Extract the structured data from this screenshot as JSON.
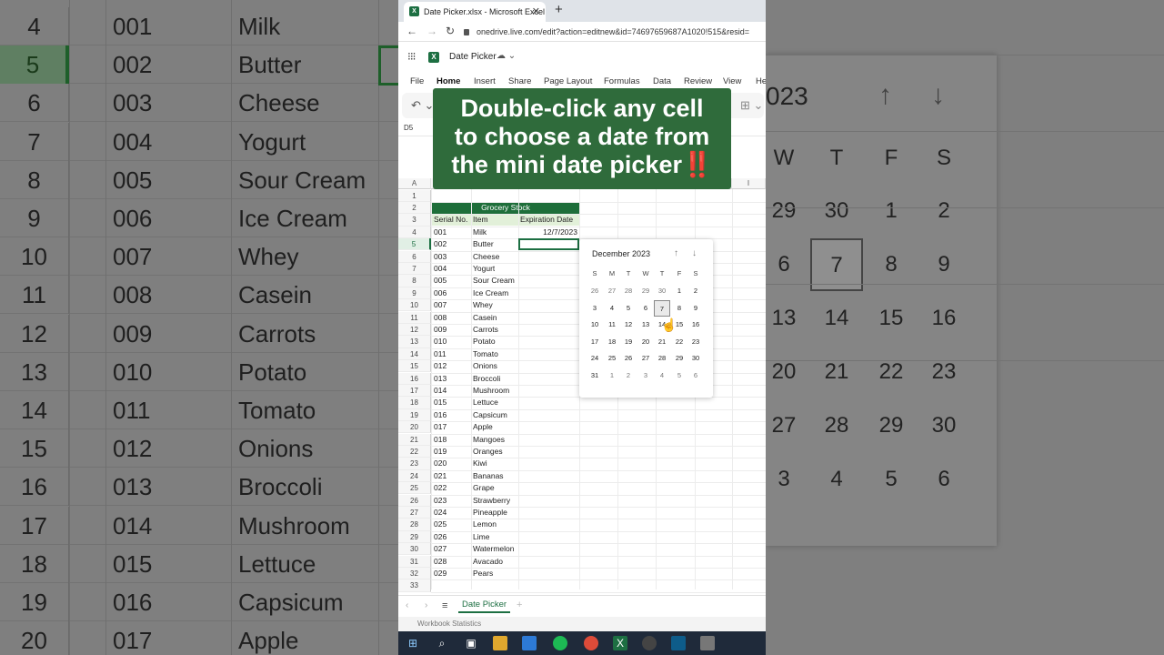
{
  "browser": {
    "tab_title": "Date Picker.xlsx - Microsoft Excel",
    "tab_close": "✕",
    "new_tab": "+",
    "url": "onedrive.live.com/edit?action=editnew&id=74697659687A1020!515&resid="
  },
  "app": {
    "doc_title": "Date Picker",
    "ribbon_tabs": [
      "File",
      "Home",
      "Insert",
      "Share",
      "Page Layout",
      "Formulas",
      "Data",
      "Review",
      "View",
      "He"
    ],
    "name_box": "D5"
  },
  "caption": {
    "line1": "Double-click any cell",
    "line2": "to choose a date from",
    "line3": "the mini date picker",
    "emoji": "‼️"
  },
  "sheet": {
    "col_headers": [
      "A",
      "",
      "",
      "",
      "",
      "",
      "",
      "",
      "I"
    ],
    "table_title": "Grocery Stock",
    "headers": [
      "Serial No.",
      "Item",
      "Expiration Date"
    ],
    "rows": [
      [
        "001",
        "Milk",
        "12/7/2023"
      ],
      [
        "002",
        "Butter",
        ""
      ],
      [
        "003",
        "Cheese",
        ""
      ],
      [
        "004",
        "Yogurt",
        ""
      ],
      [
        "005",
        "Sour Cream",
        ""
      ],
      [
        "006",
        "Ice Cream",
        ""
      ],
      [
        "007",
        "Whey",
        ""
      ],
      [
        "008",
        "Casein",
        ""
      ],
      [
        "009",
        "Carrots",
        ""
      ],
      [
        "010",
        "Potato",
        ""
      ],
      [
        "011",
        "Tomato",
        ""
      ],
      [
        "012",
        "Onions",
        ""
      ],
      [
        "013",
        "Broccoli",
        ""
      ],
      [
        "014",
        "Mushroom",
        ""
      ],
      [
        "015",
        "Lettuce",
        ""
      ],
      [
        "016",
        "Capsicum",
        ""
      ],
      [
        "017",
        "Apple",
        ""
      ],
      [
        "018",
        "Mangoes",
        ""
      ],
      [
        "019",
        "Oranges",
        ""
      ],
      [
        "020",
        "Kiwi",
        ""
      ],
      [
        "021",
        "Bananas",
        ""
      ],
      [
        "022",
        "Grape",
        ""
      ],
      [
        "023",
        "Strawberry",
        ""
      ],
      [
        "024",
        "Pineapple",
        ""
      ],
      [
        "025",
        "Lemon",
        ""
      ],
      [
        "026",
        "Lime",
        ""
      ],
      [
        "027",
        "Watermelon",
        ""
      ],
      [
        "028",
        "Avacado",
        ""
      ],
      [
        "029",
        "Pears",
        ""
      ]
    ],
    "selected_row": 5
  },
  "picker": {
    "month_title": "December 2023",
    "up": "↑",
    "down": "↓",
    "weekdays": [
      "S",
      "M",
      "T",
      "W",
      "T",
      "F",
      "S"
    ],
    "weeks": [
      [
        "26",
        "27",
        "28",
        "29",
        "30",
        "1",
        "2"
      ],
      [
        "3",
        "4",
        "5",
        "6",
        "7",
        "8",
        "9"
      ],
      [
        "10",
        "11",
        "12",
        "13",
        "14",
        "15",
        "16"
      ],
      [
        "17",
        "18",
        "19",
        "20",
        "21",
        "22",
        "23"
      ],
      [
        "24",
        "25",
        "26",
        "27",
        "28",
        "29",
        "30"
      ],
      [
        "31",
        "1",
        "2",
        "3",
        "4",
        "5",
        "6"
      ]
    ],
    "today": "7"
  },
  "zoom_calendar": {
    "year_fragment": "023",
    "weekdays": [
      "W",
      "T",
      "F",
      "S"
    ],
    "weeks": [
      [
        "29",
        "30",
        "1",
        "2"
      ],
      [
        "6",
        "7",
        "8",
        "9"
      ],
      [
        "13",
        "14",
        "15",
        "16"
      ],
      [
        "20",
        "21",
        "22",
        "23"
      ],
      [
        "27",
        "28",
        "29",
        "30"
      ],
      [
        "3",
        "4",
        "5",
        "6"
      ]
    ]
  },
  "sheet_tabs": {
    "active": "Date Picker",
    "add": "+"
  },
  "status": "Workbook Statistics"
}
